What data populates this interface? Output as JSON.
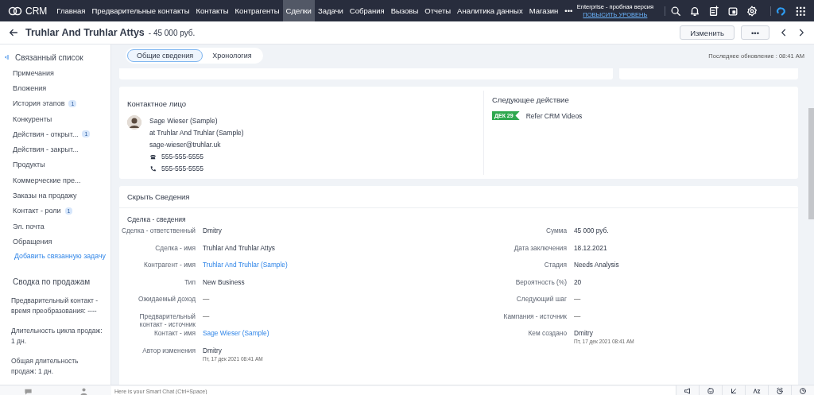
{
  "topbar": {
    "brand": "CRM",
    "nav": [
      {
        "label": "Главная",
        "selected": false
      },
      {
        "label": "Предварительные контакты",
        "selected": false
      },
      {
        "label": "Контакты",
        "selected": false
      },
      {
        "label": "Контрагенты",
        "selected": false
      },
      {
        "label": "Сделки",
        "selected": true
      },
      {
        "label": "Задачи",
        "selected": false
      },
      {
        "label": "Собрания",
        "selected": false
      },
      {
        "label": "Вызовы",
        "selected": false
      },
      {
        "label": "Отчеты",
        "selected": false
      },
      {
        "label": "Аналитика данных",
        "selected": false
      },
      {
        "label": "Магазин",
        "selected": false
      }
    ],
    "more": "•••",
    "edition": "Enterprise - пробная версия",
    "upgrade": "ПОВЫСИТЬ УРОВЕНЬ"
  },
  "header": {
    "title": "Truhlar And Truhlar Attys",
    "amount": "- 45 000 руб.",
    "edit_button": "Изменить",
    "more_button": "•••"
  },
  "sidebar": {
    "title": "Связанный список",
    "items": [
      {
        "label": "Примечания"
      },
      {
        "label": "Вложения"
      },
      {
        "label": "История этапов",
        "count": "1"
      },
      {
        "label": "Конкуренты"
      },
      {
        "label": "Действия - открыт...",
        "count": "1"
      },
      {
        "label": "Действия - закрыт..."
      },
      {
        "label": "Продукты"
      },
      {
        "label": "Коммерческие пре..."
      },
      {
        "label": "Заказы на продажу"
      },
      {
        "label": "Контакт - роли",
        "count": "1"
      },
      {
        "label": "Эл. почта"
      },
      {
        "label": "Обращения"
      }
    ],
    "add_link": "Добавить связанную задачу",
    "summary_title": "Сводка по продажам",
    "summary": [
      "Предварительный контакт - время преобразования: ----",
      "Длительность цикла продаж: 1 дн.",
      "Общая длительность продаж: 1 дн."
    ]
  },
  "tabs": [
    {
      "label": "Общие сведения",
      "selected": true
    },
    {
      "label": "Хронология",
      "selected": false
    }
  ],
  "last_update": "Последнее обновление : 08:41 AM",
  "contact": {
    "title": "Контактное лицо",
    "name": "Sage Wieser (Sample)",
    "company": "at Truhlar And Truhlar (Sample)",
    "email": "sage-wieser@truhlar.uk",
    "phone": "555-555-5555",
    "mobile": "555-555-5555"
  },
  "next_action": {
    "title": "Следующее действие",
    "date": "ДЕК 29",
    "subject": "Refer CRM Videos"
  },
  "details": {
    "title": "Скрыть Сведения",
    "section": "Сделка - сведения",
    "left": [
      {
        "label": "Сделка - ответственный",
        "value": "Dmitry",
        "kind": "text"
      },
      {
        "label": "Сделка - имя",
        "value": "Truhlar And Truhlar Attys",
        "kind": "text"
      },
      {
        "label": "Контрагент - имя",
        "value": "Truhlar And Truhlar (Sample)",
        "kind": "link"
      },
      {
        "label": "Тип",
        "value": "New Business",
        "kind": "text"
      },
      {
        "label": "Ожидаемый доход",
        "value": "—",
        "kind": "empty"
      },
      {
        "label": "Предварительный контакт - источник",
        "value": "—",
        "kind": "empty"
      },
      {
        "label": "Контакт - имя",
        "value": "Sage Wieser (Sample)",
        "kind": "link"
      },
      {
        "label": "Автор изменения",
        "value": "Dmitry",
        "kind": "text",
        "sub": "Пт, 17 дек 2021 08:41 AM"
      }
    ],
    "right": [
      {
        "label": "Сумма",
        "value": "45 000 руб.",
        "kind": "text"
      },
      {
        "label": "Дата заключения",
        "value": "18.12.2021",
        "kind": "text"
      },
      {
        "label": "Стадия",
        "value": "Needs Analysis",
        "kind": "text"
      },
      {
        "label": "Вероятность (%)",
        "value": "20",
        "kind": "text"
      },
      {
        "label": "Следующий шаг",
        "value": "—",
        "kind": "empty"
      },
      {
        "label": "Кампания - источник",
        "value": "—",
        "kind": "empty"
      },
      {
        "label": "Кем создано",
        "value": "Dmitry",
        "kind": "text",
        "sub": "Пт, 17 дек 2021 08:41 AM"
      }
    ]
  },
  "smart_chat": {
    "placeholder": "Here is your Smart Chat (Ctrl+Space)"
  }
}
